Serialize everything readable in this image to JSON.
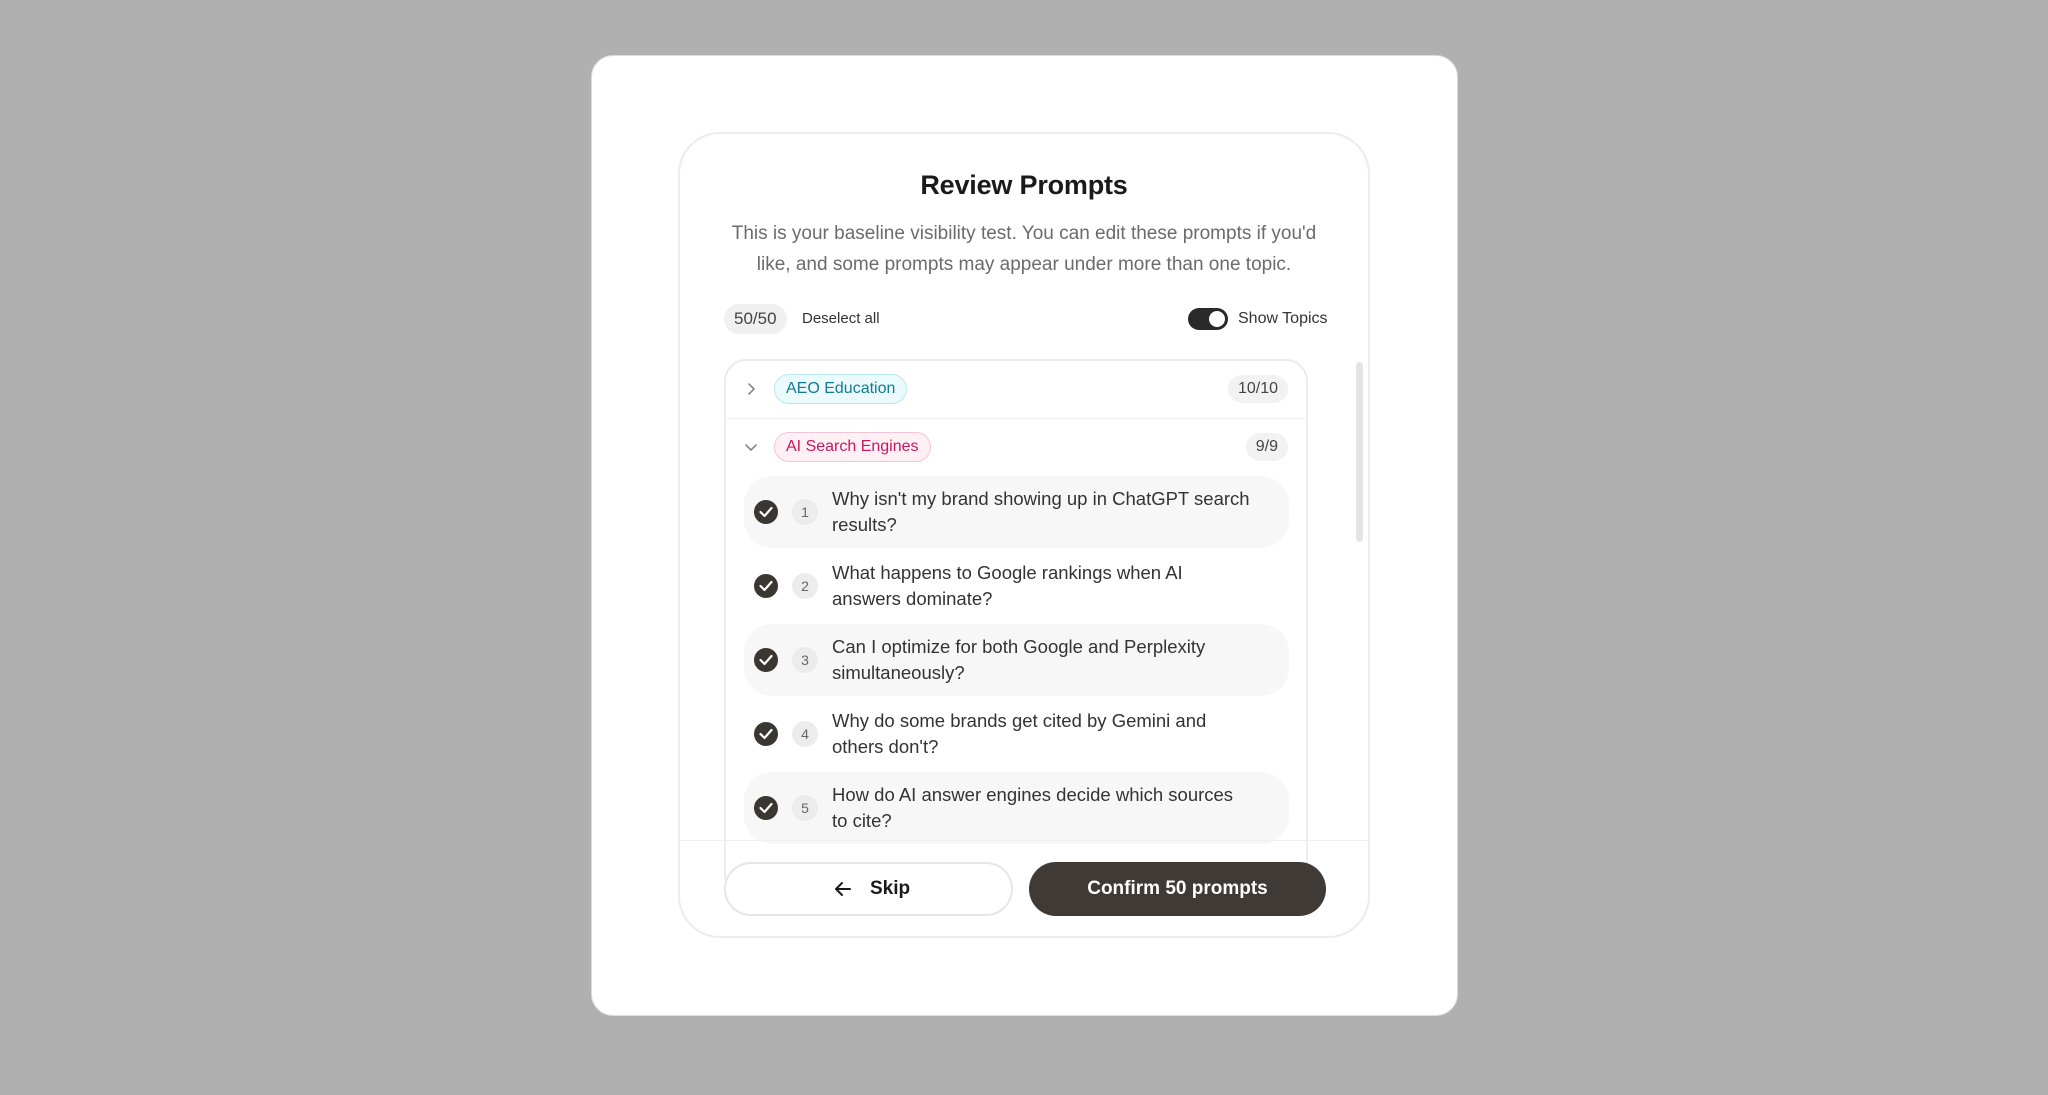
{
  "dialog": {
    "title": "Review Prompts",
    "subtitle": "This is your baseline visibility test. You can edit these prompts if you'd like, and some prompts may appear under more than one topic."
  },
  "controls": {
    "selected_count": "50/50",
    "deselect_label": "Deselect all",
    "show_topics_label": "Show Topics",
    "show_topics_on": true
  },
  "topics": [
    {
      "label": "AEO Education",
      "count": "10/10",
      "expanded": false,
      "color": "#137a92"
    },
    {
      "label": "AI Search Engines",
      "count": "9/9",
      "expanded": true,
      "color": "#c8185f"
    }
  ],
  "prompts": [
    {
      "num": "1",
      "text": "Why isn't my brand showing up in ChatGPT search results?",
      "checked": true
    },
    {
      "num": "2",
      "text": "What happens to Google rankings when AI answers dominate?",
      "checked": true
    },
    {
      "num": "3",
      "text": "Can I optimize for both Google and Perplexity simultaneously?",
      "checked": true
    },
    {
      "num": "4",
      "text": "Why do some brands get cited by Gemini and others don't?",
      "checked": true
    },
    {
      "num": "5",
      "text": "How do AI answer engines decide which sources to cite?",
      "checked": true
    }
  ],
  "footer": {
    "skip_label": "Skip",
    "confirm_label": "Confirm 50 prompts"
  },
  "colors": {
    "primary_button": "#3f3a35",
    "overlay": "#b0b0b0"
  }
}
